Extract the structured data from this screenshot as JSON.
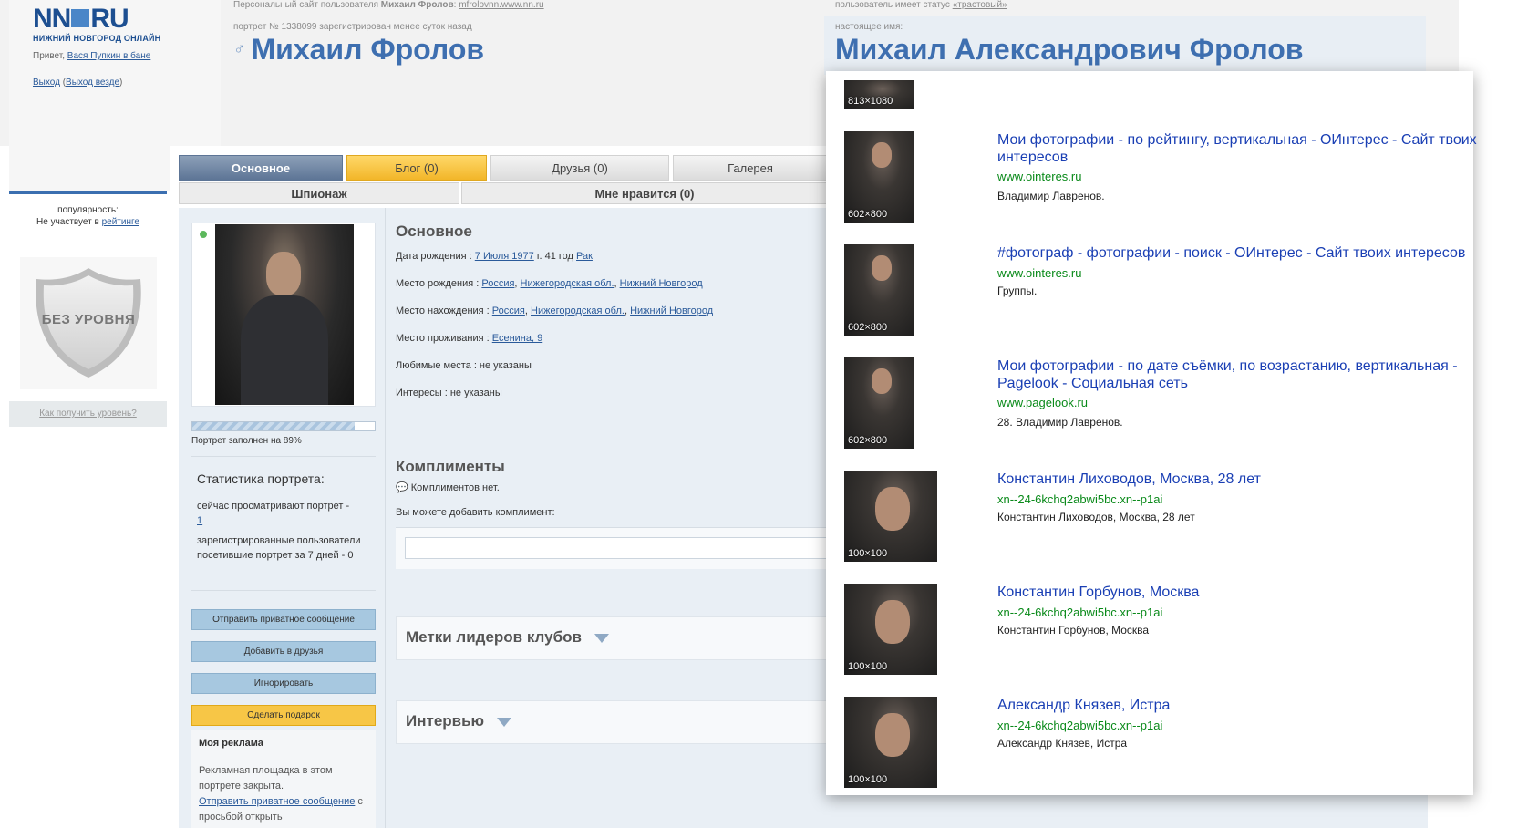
{
  "site": {
    "logo_main_a": "NN",
    "logo_main_b": "RU",
    "logo_sub": "НИЖНИЙ НОВГОРОД ОНЛАЙН",
    "greet_prefix": "Привет, ",
    "greet_user": "Вася Пупкин в бане",
    "logout": "Выход",
    "logout_all": "Выход везде",
    "logout_open": " (",
    "logout_close": ")"
  },
  "header": {
    "personal_site_prefix": "Персональный сайт пользователя ",
    "personal_site_user": "Михаил Фролов",
    "personal_site_sep": ": ",
    "personal_site_url": "mfrolovnn.www.nn.ru",
    "status_prefix": "пользователь имеет статус ",
    "status_link": "«трастовый»",
    "portrait_reg": "портрет № 1338099 зарегистрирован менее суток назад",
    "real_name_label": "настоящее имя:",
    "name": "Михаил Фролов",
    "real_name": "Михаил Александрович Фролов",
    "male_symbol": "♂"
  },
  "left": {
    "popularity_label": "популярность:",
    "popularity_prefix": "Не участвует в ",
    "popularity_link": "рейтинге",
    "level_badge": "БЕЗ УРОВНЯ",
    "how_to_level": "Как получить уровень?"
  },
  "tabs": {
    "row1": [
      "Основное",
      "Блог (0)",
      "Друзья (0)",
      "Галерея"
    ],
    "row2": [
      "Шпионаж",
      "Мне нравится (0)"
    ]
  },
  "profile": {
    "fill_percent": 89,
    "fill_text": "Портрет заполнен на 89%",
    "stats_title": "Статистика портрета:",
    "viewing_now": "сейчас просматривают портрет -",
    "viewing_now_count": "1",
    "visitors_7d": "зарегистрированные пользователи посетившие портрет за 7 дней - 0",
    "buttons": {
      "private_msg": "Отправить приватное сообщение",
      "add_friend": "Добавить в друзья",
      "ignore": "Игнорировать",
      "gift": "Сделать подарок"
    },
    "ad_title": "Моя реклама",
    "ad_text": "Рекламная площадка в этом портрете закрыта.",
    "ad_link": "Отправить приватное сообщение",
    "ad_suffix": " с просьбой открыть"
  },
  "main": {
    "section_title": "Основное",
    "birth_label": "Дата рождения : ",
    "birth_date": "7 Июля 1977",
    "birth_age": " г. 41 год ",
    "birth_sign": "Рак",
    "birthplace_label": "Место рождения : ",
    "location_label": "Место нахождения : ",
    "residence_label": "Место проживания : ",
    "residence": "Есенина, 9",
    "place_country": "Россия",
    "place_region": "Нижегородская обл.",
    "place_city": "Нижний Новгород",
    "comma": ", ",
    "fav_places": "Любимые места : не указаны",
    "interests": "Интересы : не указаны",
    "compliments_title": "Комплименты",
    "compliments_none": "Комплиментов нет.",
    "compliments_add": "Вы можете добавить комплимент:",
    "club_marks": "Метки лидеров клубов",
    "interview": "Интервью"
  },
  "search_results": [
    {
      "size": "813×1080",
      "title": "",
      "url": "",
      "desc": ""
    },
    {
      "size": "602×800",
      "title": "Мои фотографии - по рейтингу, вертикальная - ОИнтерес - Сайт твоих интересов",
      "url": "www.ointeres.ru",
      "desc": "Владимир Лавренов."
    },
    {
      "size": "602×800",
      "title": "#фотограф - фотографии - поиск - ОИнтерес - Сайт твоих интересов",
      "url": "www.ointeres.ru",
      "desc": "Группы."
    },
    {
      "size": "602×800",
      "title": "Мои фотографии - по дате съёмки, по возрастанию, вертикальная - Pagelook - Социальная сеть",
      "url": "www.pagelook.ru",
      "desc": "28. Владимир Лавренов."
    },
    {
      "size": "100×100",
      "title": "Константин Лиховодов, Москва, 28 лет",
      "url": "xn--24-6kchq2abwi5bc.xn--p1ai",
      "desc": "Константин Лиховодов, Москва, 28 лет"
    },
    {
      "size": "100×100",
      "title": "Константин Горбунов, Москва",
      "url": "xn--24-6kchq2abwi5bc.xn--p1ai",
      "desc": "Константин Горбунов, Москва"
    },
    {
      "size": "100×100",
      "title": "Александр Князев, Истра",
      "url": "xn--24-6kchq2abwi5bc.xn--p1ai",
      "desc": "Александр Князев, Истра"
    }
  ]
}
